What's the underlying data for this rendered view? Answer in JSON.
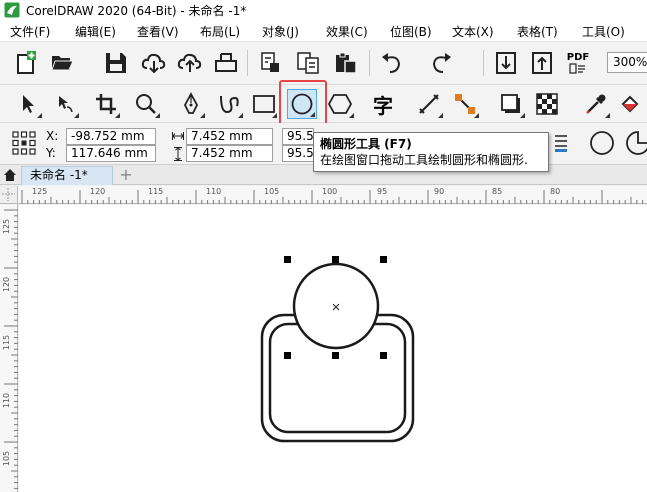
{
  "window": {
    "title": "CorelDRAW 2020 (64-Bit) - 未命名 -1*"
  },
  "menu": {
    "file": "文件(F)",
    "edit": "编辑(E)",
    "view": "查看(V)",
    "layout": "布局(L)",
    "object": "对象(J)",
    "effects": "效果(C)",
    "bitmaps": "位图(B)",
    "text": "文本(X)",
    "table": "表格(T)",
    "tools": "工具(O)"
  },
  "toolbar": {
    "zoom_value": "300%",
    "pdf_label": "PDF"
  },
  "toolbox": {
    "text_tool_glyph": "字"
  },
  "propbar": {
    "x_label": "X:",
    "x_value": "-98.752 mm",
    "y_label": "Y:",
    "y_value": "117.646 mm",
    "width_value": "7.452 mm",
    "height_value": "7.452 mm",
    "scale_x": "95.5",
    "scale_y": "95.5"
  },
  "tooltip": {
    "title": "椭圆形工具 (F7)",
    "description": "在绘图窗口拖动工具绘制圆形和椭圆形."
  },
  "tabs": {
    "document_tab": "未命名 -1*",
    "add_tab": "+"
  },
  "ruler": {
    "h_labels": [
      "125",
      "120",
      "115",
      "110",
      "105",
      "100",
      "95",
      "90",
      "85",
      "80"
    ],
    "v_labels": [
      "125",
      "120",
      "115",
      "110",
      "105"
    ]
  },
  "colors": {
    "accent_highlight": "#e64545",
    "tool_active_bg": "#cfe6f7",
    "tool_active_border": "#52a6df",
    "tab_active_bg": "#d8e6f3"
  }
}
